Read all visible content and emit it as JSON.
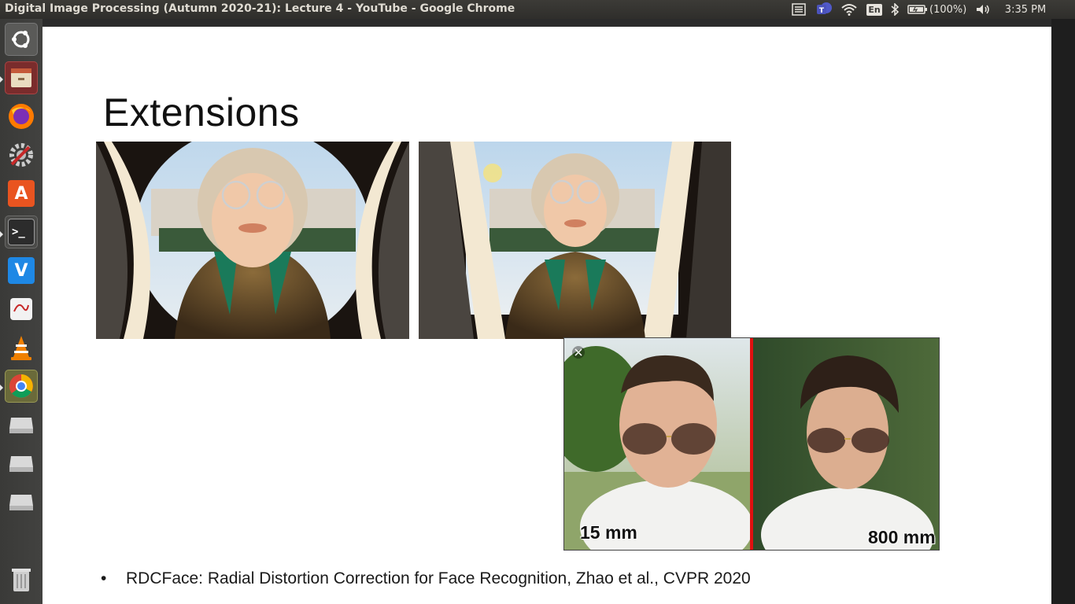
{
  "window": {
    "title": "Digital Image Processing (Autumn 2020-21): Lecture 4 - YouTube - Google Chrome"
  },
  "tray": {
    "keyboard_layout": "En",
    "battery": "(100%)",
    "clock": "3:35 PM",
    "icons": [
      "menu-icon",
      "teams-icon",
      "wifi-icon",
      "keyboard-layout-indicator",
      "bluetooth-icon",
      "battery-icon",
      "volume-icon"
    ]
  },
  "launcher": {
    "items": [
      {
        "name": "ubuntu-dash",
        "icon": "ubuntu-logo-icon",
        "color": "#5a5a58"
      },
      {
        "name": "files",
        "icon": "file-cabinet-icon",
        "color": "#8b3a3a"
      },
      {
        "name": "firefox",
        "icon": "firefox-icon",
        "color": "#e66000"
      },
      {
        "name": "system-settings",
        "icon": "settings-tools-icon",
        "color": "#555555"
      },
      {
        "name": "software-center",
        "icon": "software-center-icon",
        "color": "#e95420"
      },
      {
        "name": "terminal",
        "icon": "terminal-icon",
        "color": "#2c2c2c"
      },
      {
        "name": "vscode",
        "icon": "vscode-icon",
        "color": "#1e88e5"
      },
      {
        "name": "document-viewer",
        "icon": "document-viewer-icon",
        "color": "#eeeeee"
      },
      {
        "name": "vlc",
        "icon": "vlc-cone-icon",
        "color": "#f08000"
      },
      {
        "name": "chrome",
        "icon": "chrome-icon",
        "color": "#4285f4"
      },
      {
        "name": "drive-1",
        "icon": "disk-drive-icon",
        "color": "#cfcfcf"
      },
      {
        "name": "drive-2",
        "icon": "disk-drive-icon",
        "color": "#cfcfcf"
      },
      {
        "name": "drive-3",
        "icon": "disk-drive-icon",
        "color": "#cfcfcf"
      },
      {
        "name": "trash",
        "icon": "trash-icon",
        "color": "#bdbdbd"
      }
    ],
    "terminal_glyph": ">_",
    "vscode_glyph": "V",
    "software_glyph": "A"
  },
  "slide": {
    "title": "Extensions",
    "bullet": "RDCFace: Radial Distortion Correction for Face Recognition, Zhao et al., CVPR 2020",
    "bullet_marker": "•",
    "face_comparison": {
      "left_label": "15 mm",
      "right_label": "800 mm"
    }
  }
}
